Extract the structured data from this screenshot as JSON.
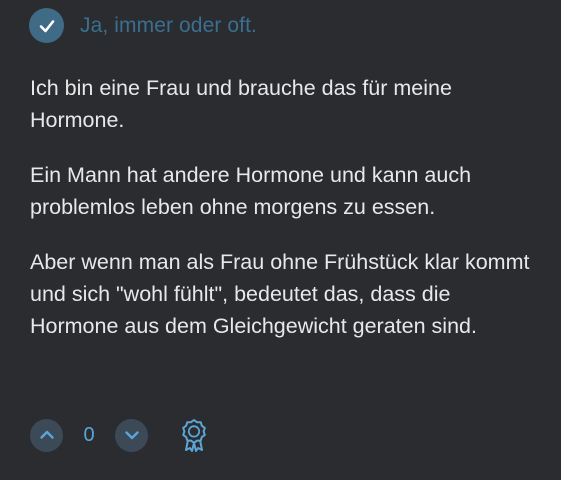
{
  "answer": {
    "choice_label": "Ja, immer oder oft.",
    "choice_icon": "checkmark-icon",
    "accent_color": "#3f6b86",
    "paragraphs": [
      "Ich bin eine Frau und brauche das für meine Hormone.",
      "Ein Mann hat andere Hormone und kann auch problemlos leben ohne morgens zu essen.",
      "Aber wenn man als Frau ohne Frühstück klar kommt und sich \"wohl fühlt\", bedeutet das, dass die Hormone aus dem Gleichgewicht geraten sind."
    ]
  },
  "votes": {
    "count": "0",
    "upvote_icon": "chevron-up-icon",
    "downvote_icon": "chevron-down-icon",
    "award_icon": "award-ribbon-icon",
    "vote_color": "#5aa6d8"
  }
}
